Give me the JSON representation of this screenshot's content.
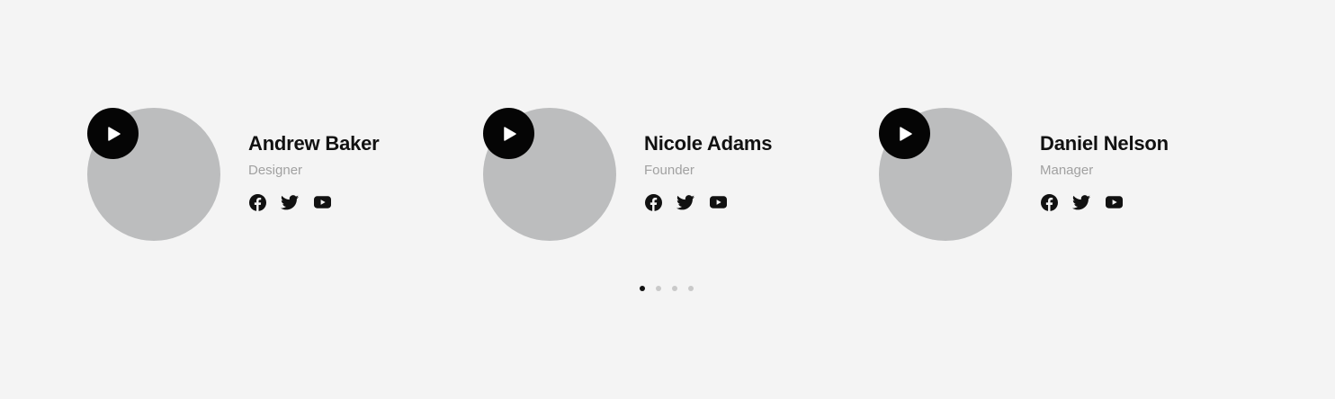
{
  "team": [
    {
      "name": "Andrew Baker",
      "role": "Designer",
      "socials": [
        "facebook-icon",
        "twitter-icon",
        "youtube-icon"
      ]
    },
    {
      "name": "Nicole Adams",
      "role": "Founder",
      "socials": [
        "facebook-icon",
        "twitter-icon",
        "youtube-icon"
      ]
    },
    {
      "name": "Daniel Nelson",
      "role": "Manager",
      "socials": [
        "facebook-icon",
        "twitter-icon",
        "youtube-icon"
      ]
    }
  ],
  "pagination": {
    "total": 4,
    "active_index": 0
  },
  "colors": {
    "background": "#f4f4f4",
    "photo_placeholder": "#bcbdbe",
    "play_button": "#050505",
    "role_text": "#a1a1a1",
    "dot_active": "#111111",
    "dot_inactive": "#c9c9c9"
  }
}
